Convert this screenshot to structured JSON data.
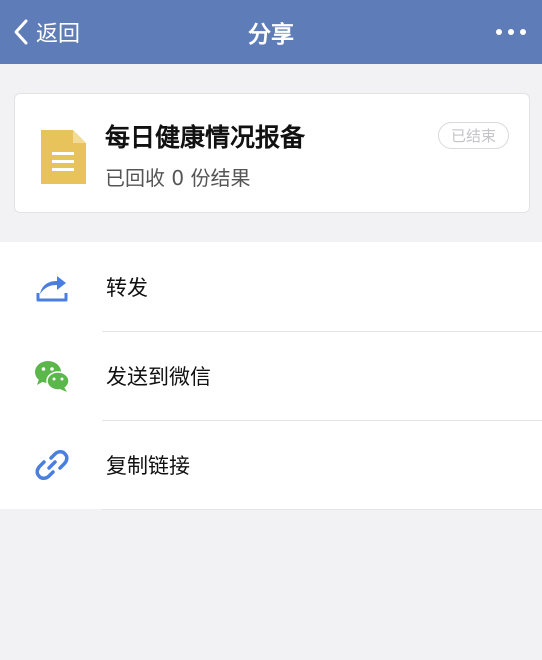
{
  "navbar": {
    "back_label": "返回",
    "title": "分享"
  },
  "card": {
    "title": "每日健康情况报备",
    "subtitle": "已回收 0 份结果",
    "status": "已结束"
  },
  "menu": {
    "items": [
      {
        "label": "转发",
        "icon": "share-forward-icon"
      },
      {
        "label": "发送到微信",
        "icon": "wechat-icon"
      },
      {
        "label": "复制链接",
        "icon": "link-icon"
      }
    ]
  },
  "colors": {
    "navbar": "#5e7db8",
    "accent_blue": "#4a7fe0",
    "wechat_green": "#5bb64b",
    "doc_yellow": "#e8c25a"
  }
}
